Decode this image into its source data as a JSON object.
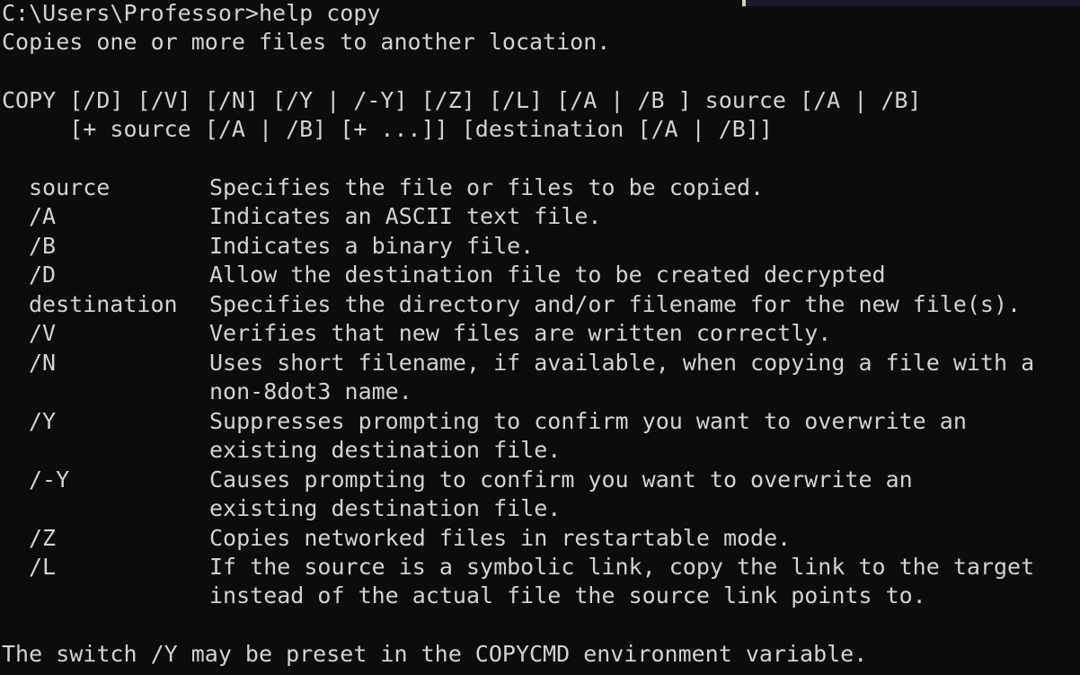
{
  "prompt_line": "C:\\Users\\Professor>help copy",
  "summary": "Copies one or more files to another location.",
  "syntax": [
    "COPY [/D] [/V] [/N] [/Y | /-Y] [/Z] [/L] [/A | /B ] source [/A | /B]",
    "     [+ source [/A | /B] [+ ...]] [destination [/A | /B]]"
  ],
  "options": [
    {
      "switch": "source",
      "desc": [
        "Specifies the file or files to be copied."
      ]
    },
    {
      "switch": "/A",
      "desc": [
        "Indicates an ASCII text file."
      ]
    },
    {
      "switch": "/B",
      "desc": [
        "Indicates a binary file."
      ]
    },
    {
      "switch": "/D",
      "desc": [
        "Allow the destination file to be created decrypted"
      ]
    },
    {
      "switch": "destination",
      "desc": [
        "Specifies the directory and/or filename for the new file(s)."
      ]
    },
    {
      "switch": "/V",
      "desc": [
        "Verifies that new files are written correctly."
      ]
    },
    {
      "switch": "/N",
      "desc": [
        "Uses short filename, if available, when copying a file with a",
        "non-8dot3 name."
      ]
    },
    {
      "switch": "/Y",
      "desc": [
        "Suppresses prompting to confirm you want to overwrite an",
        "existing destination file."
      ]
    },
    {
      "switch": "/-Y",
      "desc": [
        "Causes prompting to confirm you want to overwrite an",
        "existing destination file."
      ]
    },
    {
      "switch": "/Z",
      "desc": [
        "Copies networked files in restartable mode."
      ]
    },
    {
      "switch": "/L",
      "desc": [
        "If the source is a symbolic link, copy the link to the target",
        "instead of the actual file the source link points to."
      ]
    }
  ],
  "footer": "The switch /Y may be preset in the COPYCMD environment variable.",
  "colors": {
    "background": "#0c0c0c",
    "text": "#d2d2d2"
  }
}
